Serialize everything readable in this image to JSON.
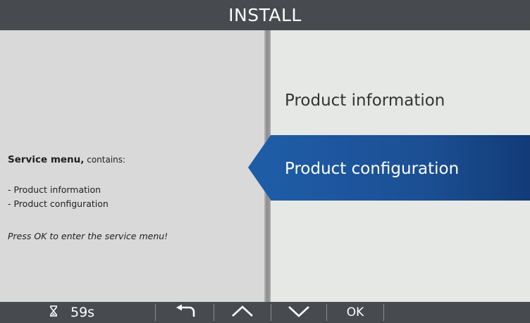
{
  "header": {
    "title": "INSTALL"
  },
  "info_panel": {
    "heading_bold": "Service menu,",
    "heading_rest": " contains:",
    "items": [
      "- Product information",
      "- Product configuration"
    ],
    "hint": "Press OK to enter the service menu!"
  },
  "menu": {
    "items": [
      {
        "label": "Product information",
        "selected": false
      },
      {
        "label": "Product configuration",
        "selected": true
      }
    ]
  },
  "footer": {
    "timer_icon": "hourglass-icon",
    "timer_value": "59s",
    "back_icon": "back-arrow-icon",
    "up_icon": "chevron-up-icon",
    "down_icon": "chevron-down-icon",
    "ok_label": "OK"
  },
  "colors": {
    "bar_background": "#474a4f",
    "selection": "#1f5ca6",
    "left_panel": "#d9d9d9",
    "right_panel": "#e6e8e6"
  }
}
